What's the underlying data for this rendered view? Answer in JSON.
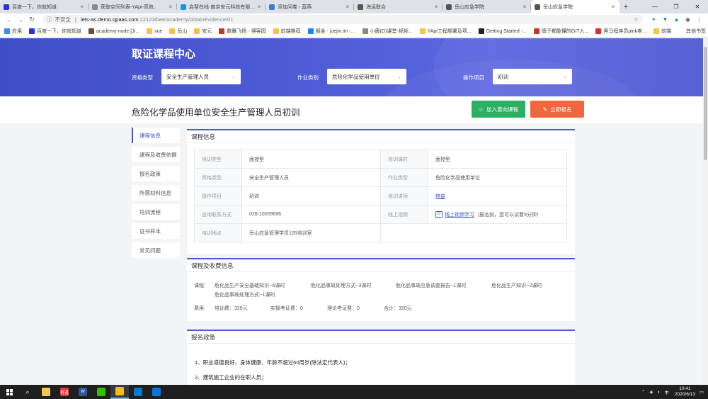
{
  "browser": {
    "tabs": [
      {
        "title": "百度一下，你就知道",
        "favicon_color": "#2932e1",
        "active": false
      },
      {
        "title": "获取空间列表-YApi-高效、",
        "favicon_color": "#8a8a8a",
        "active": false
      },
      {
        "title": "启帮在线-南京安元科技有限公司",
        "favicon_color": "#1296db",
        "active": false
      },
      {
        "title": "添加问卷 - 蓝燕",
        "favicon_color": "#3a7bd5",
        "active": false
      },
      {
        "title": "海运联合",
        "favicon_color": "#555555",
        "active": false
      },
      {
        "title": "岳山应急学院",
        "favicon_color": "#555555",
        "active": false
      },
      {
        "title": "岳山应急学院",
        "favicon_color": "#555555",
        "active": true
      }
    ],
    "new_tab_symbol": "+",
    "window_controls": [
      "—",
      "❐",
      "✕"
    ],
    "address": {
      "security_label": "不安全",
      "host": "lets-as.demo.qpaas.com",
      "path": ":22123/bee/academy/obtainEvidence/01"
    },
    "bookmarks": [
      {
        "label": "应用",
        "color": "#4285f4"
      },
      {
        "label": "百度一下，你就知道",
        "color": "#2932e1"
      },
      {
        "label": "academy-node [Ji...",
        "color": "#6b4f2a"
      },
      {
        "label": "vue",
        "color": "#f5c242"
      },
      {
        "label": "岳山",
        "color": "#f5c242"
      },
      {
        "label": "安元",
        "color": "#f5c242"
      },
      {
        "label": "数舞飞扬 - 博客园",
        "color": "#c0392b"
      },
      {
        "label": "前端推荐",
        "color": "#f5c242"
      },
      {
        "label": "掘金 - juejin.im -...",
        "color": "#1e80ff"
      },
      {
        "label": "小鹿(D)课堂-视频...",
        "color": "#888888"
      },
      {
        "label": "YApi工程部署及项...",
        "color": "#f5c242"
      },
      {
        "label": "Getting Started -...",
        "color": "#222222"
      },
      {
        "label": "牌子都能懂的GIT入...",
        "color": "#c0392b"
      },
      {
        "label": "黑马程序员pink老...",
        "color": "#d63031"
      },
      {
        "label": "前端",
        "color": "#f5c242"
      }
    ],
    "bookmarks_right": "其他书签"
  },
  "page": {
    "hero_title": "取证课程中心",
    "filters": [
      {
        "label": "资格类型",
        "value": "安全生产管理人员"
      },
      {
        "label": "作业类别",
        "value": "危险化学品使用单位"
      },
      {
        "label": "操作项目",
        "value": "初训"
      }
    ],
    "course_title": "危险化学品使用单位安全生产管理人员初训",
    "btn_add": "加入意向课程",
    "btn_signup": "立即报名",
    "sidenav": [
      "课程信息",
      "课程及收费依据",
      "报名政策",
      "所需材料信息",
      "培训流程",
      "证书样本",
      "常见问题"
    ],
    "info_title": "课程信息",
    "info_rows": [
      [
        "培训类型",
        "面授型",
        "培训课时",
        "面授型"
      ],
      [
        "资格类型",
        "安全生产管理人员",
        "作业类型",
        "危险化学品使用单位"
      ],
      [
        "操作项目",
        "初训",
        "培训讲师",
        "林俊"
      ],
      [
        "咨询联系方式",
        "028-10009696",
        "线上视频",
        "线上视频学习"
      ],
      [
        "培训地点",
        "岳山应急管理学员105培训室",
        "",
        ""
      ]
    ],
    "video_icon": "D",
    "video_note": "（报名前，您可以试看5分钟）",
    "fee_title": "课程及收费信息",
    "course_label": "课程:",
    "course_items": [
      "危化品生产安全基础知识--6课时",
      "危化品事故处理方式--3课时",
      "危化品事故应急调查报告--1课时",
      "危化品生产知识--2课时",
      "危化品事故处理方式--1课时"
    ],
    "fee_label": "费用:",
    "fees": [
      "培训费：320元",
      "实操考证费：0",
      "理论考证费：0",
      "合计：320元"
    ],
    "policy_title": "报名政策",
    "policy_items": [
      "1、职业道德良好、身体健康、年龄不超过60周岁(除法定代表人)；",
      "2、建筑施工企业的在职人员；"
    ]
  },
  "taskbar": {
    "apps": [
      {
        "name": "file-explorer",
        "color": "#f2c94c",
        "glyph": ""
      },
      {
        "name": "app-red",
        "color": "#e53935",
        "glyph": "有道"
      },
      {
        "name": "word",
        "color": "#2b579a",
        "glyph": "W"
      },
      {
        "name": "wechat",
        "color": "#2dc100",
        "glyph": ""
      },
      {
        "name": "chrome",
        "color": "#fbbc05",
        "glyph": ""
      },
      {
        "name": "vscode",
        "color": "#0078d4",
        "glyph": ""
      },
      {
        "name": "app-grid",
        "color": "#0a74da",
        "glyph": ""
      }
    ],
    "ime": "中",
    "time": "10:41",
    "date": "2020/6/13"
  }
}
